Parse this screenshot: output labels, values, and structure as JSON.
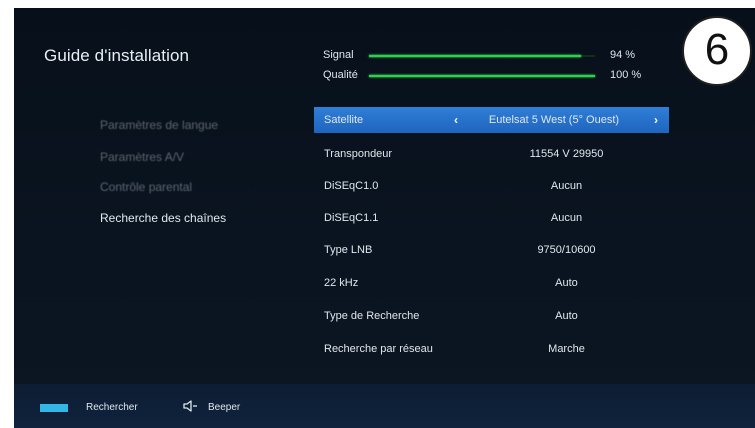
{
  "header": {
    "title": "Guide d'installation"
  },
  "meters": [
    {
      "label": "Signal",
      "value": "94 %",
      "level": 0.94
    },
    {
      "label": "Qualité",
      "value": "100 %",
      "level": 1.0
    }
  ],
  "menu": [
    {
      "label": "Paramètres de langue",
      "state": "dimmed"
    },
    {
      "label": "Paramètres A/V",
      "state": "dimmed"
    },
    {
      "label": "Contrôle parental",
      "state": "dimmed"
    },
    {
      "label": "Recherche des chaînes",
      "state": "active"
    }
  ],
  "settings": [
    {
      "label": "Satellite",
      "value": "Eutelsat 5 West (5° Ouest)",
      "selected": true
    },
    {
      "label": "Transpondeur",
      "value": "11554 V 29950"
    },
    {
      "label": "DiSEqC1.0",
      "value": "Aucun"
    },
    {
      "label": "DiSEqC1.1",
      "value": "Aucun"
    },
    {
      "label": "Type LNB",
      "value": "9750/10600"
    },
    {
      "label": "22 kHz",
      "value": "Auto"
    },
    {
      "label": "Type de Recherche",
      "value": "Auto"
    },
    {
      "label": "Recherche par réseau",
      "value": "Marche"
    }
  ],
  "footer": {
    "blue_key_label": "Rechercher",
    "speaker_label": "Beeper"
  },
  "badge": {
    "number": "6"
  },
  "colors": {
    "selection": "#2a73cf",
    "meter": "#2fd14a",
    "blue_key": "#33b6e6",
    "footer_bg": "#10223d"
  },
  "icons": {
    "left_arrow": "chevron-left-icon",
    "right_arrow": "chevron-right-icon",
    "speaker": "speaker-icon"
  }
}
